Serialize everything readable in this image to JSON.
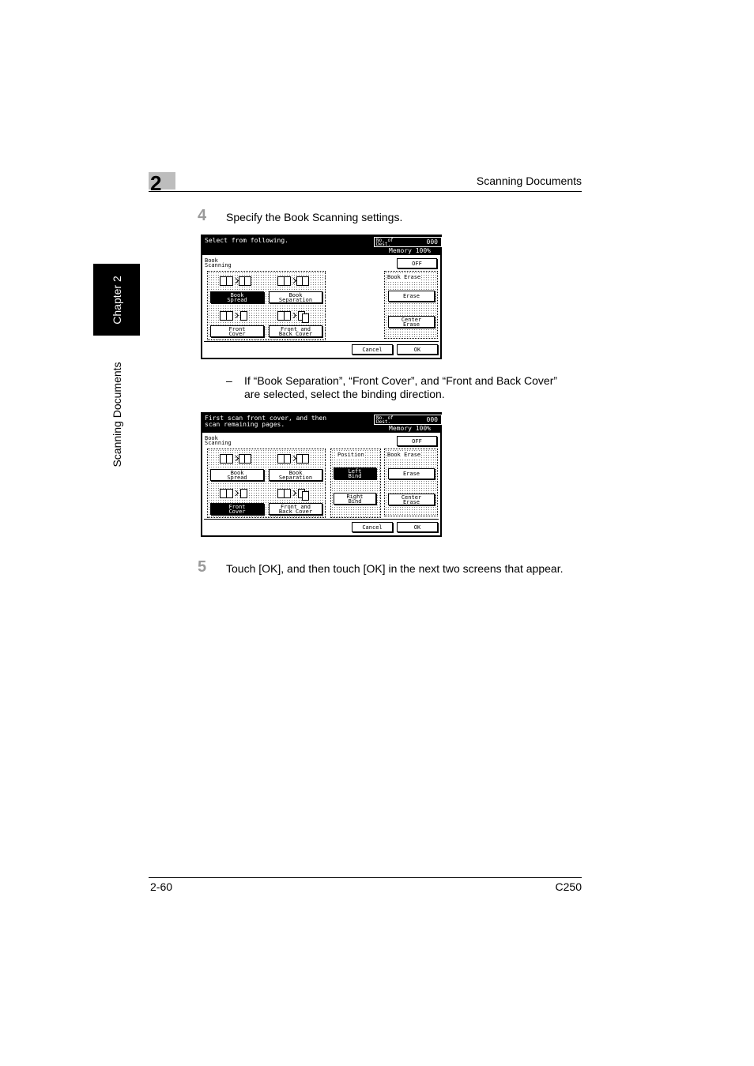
{
  "header": {
    "chapter_number": "2",
    "title": "Scanning Documents"
  },
  "sidebar": {
    "chapter": "Chapter 2",
    "section": "Scanning Documents"
  },
  "steps": [
    {
      "number": "4",
      "text": "Specify the Book Scanning settings."
    },
    {
      "number": "5",
      "text": "Touch [OK], and then touch [OK] in the next two screens that appear."
    }
  ],
  "note": {
    "dash": "–",
    "line1": "If “Book Separation”, “Front Cover”, and “Front and Back Cover”",
    "line2": "are selected, select the binding direction."
  },
  "screen1": {
    "prompt": "Select from following.",
    "dest_label": "No. of\nDest.",
    "dest_value": "000",
    "memory": "Memory 100%",
    "section_label": "Book\nScanning",
    "off": "OFF",
    "book_spread": "Book\nSpread",
    "book_separation": "Book\nSeparation",
    "front_cover": "Front\nCover",
    "front_back_cover": "Front and\nBack Cover",
    "book_erase": "Book Erase",
    "erase": "Erase",
    "center_erase": "Center\nErase",
    "cancel": "Cancel",
    "ok": "OK"
  },
  "screen2": {
    "prompt": "First scan front cover, and then\nscan remaining pages.",
    "dest_label": "No. of\nDest.",
    "dest_value": "000",
    "memory": "Memory 100%",
    "section_label": "Book\nScanning",
    "off": "OFF",
    "book_spread": "Book\nSpread",
    "book_separation": "Book\nSeparation",
    "front_cover": "Front\nCover",
    "front_back_cover": "Front and\nBack Cover",
    "position": "Position",
    "left_bind": "Left\nBind",
    "right_bind": "Right\nBind",
    "book_erase": "Book Erase",
    "erase": "Erase",
    "center_erase": "Center\nErase",
    "cancel": "Cancel",
    "ok": "OK"
  },
  "footer": {
    "page": "2-60",
    "model": "C250"
  }
}
